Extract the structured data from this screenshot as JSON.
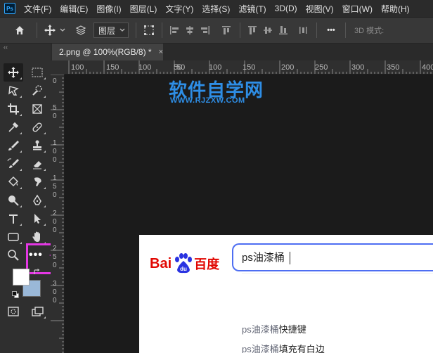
{
  "app": {
    "logo_text": "Ps"
  },
  "menu": [
    "文件(F)",
    "编辑(E)",
    "图像(I)",
    "图层(L)",
    "文字(Y)",
    "选择(S)",
    "滤镜(T)",
    "3D(D)",
    "视图(V)",
    "窗口(W)",
    "帮助(H)"
  ],
  "options": {
    "layer_select": "图层",
    "more": "•••",
    "mode_3d": "3D 模式:"
  },
  "toolbox": {
    "collapse": "‹‹",
    "more_tools": "•••"
  },
  "document": {
    "tab_title": "2.png @ 100%(RGB/8) *",
    "close": "×"
  },
  "ruler": {
    "h_labels": [
      "100",
      "150",
      "100",
      "50",
      "0",
      "50",
      "100",
      "150",
      "200",
      "250",
      "300",
      "350",
      "400"
    ],
    "v_labels": [
      "0",
      "5",
      "0",
      "1",
      "0",
      "0",
      "1",
      "5",
      "0",
      "2",
      "0",
      "0",
      "2",
      "5",
      "0",
      "3",
      "0",
      "0"
    ]
  },
  "watermark": {
    "title": "软件自学网",
    "url": "WWW.RJZXW.COM"
  },
  "baidu": {
    "logo_bai": "Bai",
    "logo_du": "du",
    "logo_cn": "百度",
    "query": "ps油漆桶",
    "suggestions": [
      {
        "prefix": "ps油漆桶",
        "suffix": "快捷键"
      },
      {
        "prefix": "ps油漆桶",
        "suffix": "填充有白边"
      }
    ]
  },
  "colors": {
    "foreground": "#ffffff",
    "background": "#9ab8d8",
    "highlight": "#e437e4",
    "baidu_red": "#e10601",
    "baidu_blue": "#2932e1",
    "search_border": "#4e6ef2",
    "watermark": "#2e8ee6"
  }
}
